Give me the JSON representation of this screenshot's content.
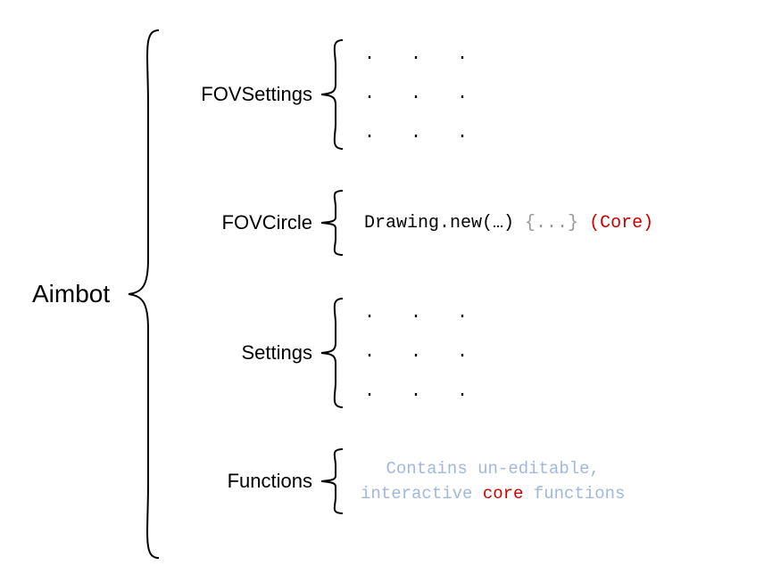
{
  "root": {
    "label": "Aimbot"
  },
  "children": [
    {
      "label": "FOVSettings",
      "content_type": "dots"
    },
    {
      "label": "FOVCircle",
      "content_type": "code",
      "code_main": "Drawing.new(…)",
      "code_placeholder": "{...}",
      "code_tag": "(Core)"
    },
    {
      "label": "Settings",
      "content_type": "dots"
    },
    {
      "label": "Functions",
      "content_type": "description",
      "desc_part1": "Contains un-editable,",
      "desc_part2a": "interactive ",
      "desc_part2b": "core",
      "desc_part2c": " functions"
    }
  ],
  "dots_line": ".  .  ."
}
